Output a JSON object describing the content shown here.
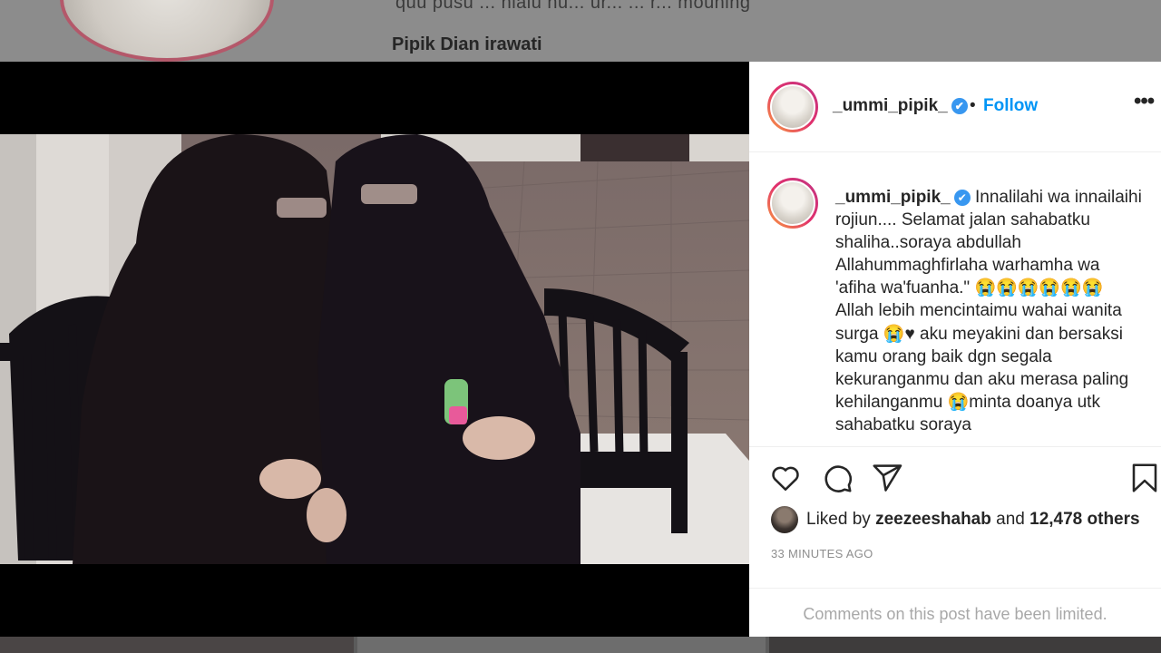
{
  "background": {
    "caption_fragment": "quu pusu ... niaiu nu... ur... ... r... mouning",
    "profile_name": "Pipik Dian irawati"
  },
  "post": {
    "username": "_ummi_pipik_",
    "verified_icon": "verified-badge-icon",
    "separator": "•",
    "follow_label": "Follow",
    "more_label": "•••",
    "caption": "Innalilahi wa innailaihi rojiun.... Selamat jalan sahabatku shaliha..soraya abdullah Allahummaghfirlaha warhamha wa 'afiha wa'fuanha.\" 😭😭😭😭😭😭 Allah lebih mencintaimu wahai wanita surga 😭♥ aku meyakini dan bersaksi kamu orang baik dgn segala kekuranganmu dan aku merasa paling kehilanganmu 😭minta doanya utk sahabatku soraya",
    "icons": [
      "heart-icon",
      "comment-icon",
      "share-icon",
      "bookmark-icon"
    ],
    "liked_prefix": "Liked by",
    "liked_user": "zeezeeshahab",
    "liked_middle": "and",
    "liked_count": "12,478 others",
    "timestamp": "33 MINUTES AGO",
    "comments_notice": "Comments on this post have been limited."
  },
  "colors": {
    "accent": "#0095f6",
    "verified": "#3897f0",
    "text": "#262626",
    "muted": "#8e8e8e"
  }
}
